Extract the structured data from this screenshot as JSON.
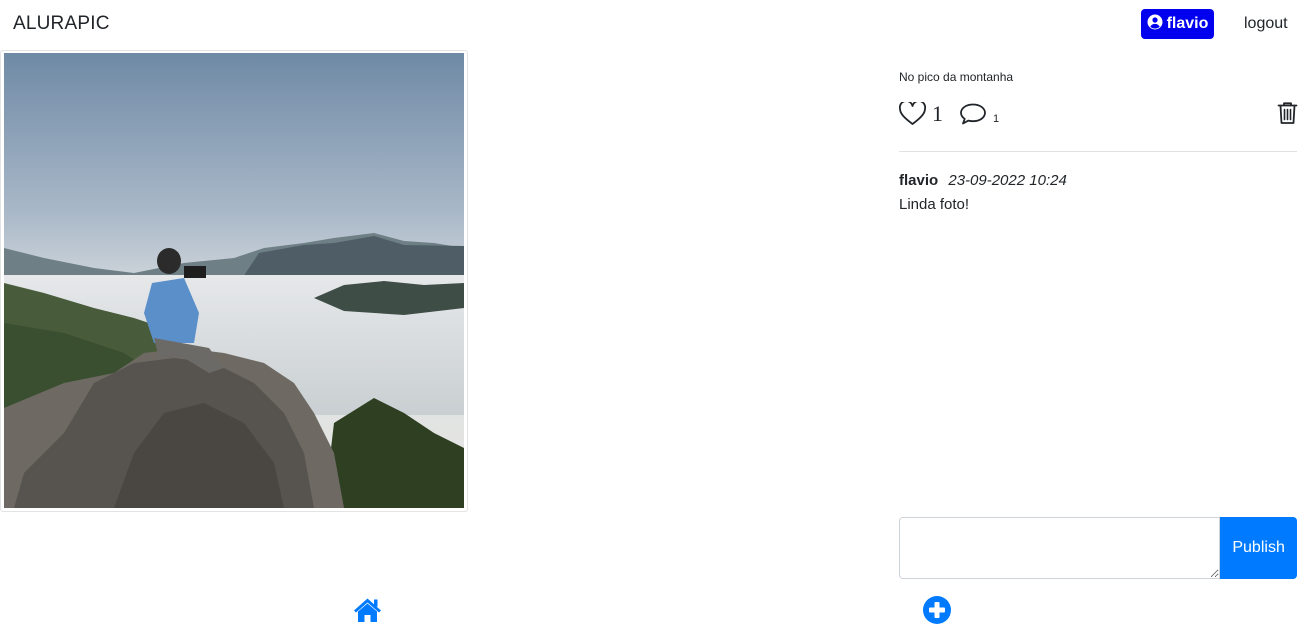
{
  "navbar": {
    "brand": "ALURAPIC",
    "user_name": "flavio",
    "user_icon": "user-circle-icon",
    "logout_label": "logout"
  },
  "photo": {
    "description": "No pico da montanha",
    "likes": "1",
    "comments_count": "1"
  },
  "comments": [
    {
      "user": "flavio",
      "date": "23-09-2022 10:24",
      "text": "Linda foto!"
    }
  ],
  "comment_form": {
    "value": "",
    "publish_label": "Publish"
  },
  "footer": {
    "home_icon": "home-icon",
    "add_icon": "plus-circle-icon"
  },
  "colors": {
    "user_badge": "#0000ee",
    "primary": "#007bff"
  }
}
